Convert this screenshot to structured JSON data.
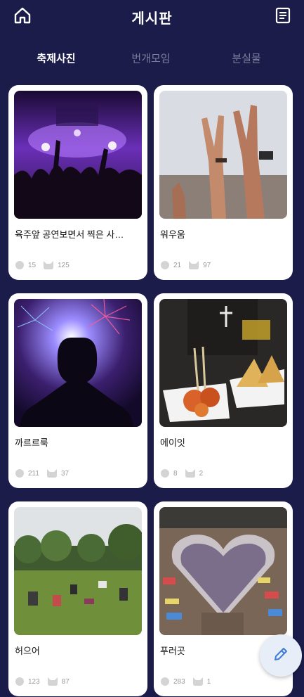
{
  "header": {
    "title": "게시판",
    "home_icon": "home-icon",
    "menu_icon": "list-icon"
  },
  "tabs": [
    {
      "label": "축제사진",
      "active": true
    },
    {
      "label": "번개모임",
      "active": false
    },
    {
      "label": "분실물",
      "active": false
    }
  ],
  "posts": [
    {
      "title": "육주앞 공연보면서 찍은 사…",
      "comments": "15",
      "likes": "125",
      "image": "concert-crowd-purple-lights"
    },
    {
      "title": "워우움",
      "comments": "21",
      "likes": "97",
      "image": "hands-raised-rock-sign"
    },
    {
      "title": "까르르룩",
      "comments": "211",
      "likes": "37",
      "image": "fireworks-silhouette"
    },
    {
      "title": "에이잇",
      "comments": "8",
      "likes": "2",
      "image": "street-food-samosa"
    },
    {
      "title": "허으어",
      "comments": "123",
      "likes": "87",
      "image": "park-picnic-crowd"
    },
    {
      "title": "푸러곳",
      "comments": "283",
      "likes": "1",
      "image": "book-market-heart"
    }
  ],
  "fab": {
    "icon": "pencil-icon"
  },
  "colors": {
    "background": "#1b1c4a",
    "card": "#ffffff",
    "tab_inactive": "#7b7e9c",
    "fab": "#e8eef7",
    "fab_icon": "#3d7fd6"
  }
}
